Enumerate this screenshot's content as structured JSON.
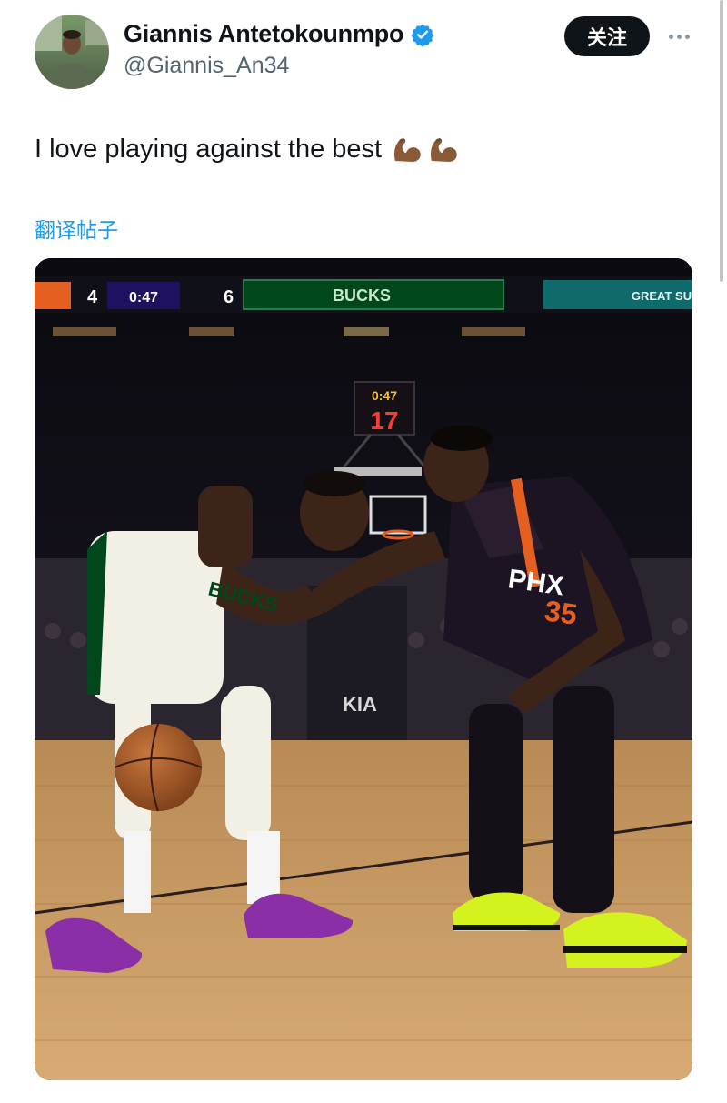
{
  "author": {
    "display_name": "Giannis Antetokounmpo",
    "handle": "@Giannis_An34",
    "avatar_icon": "avatar-photo",
    "verified_icon": "verified-badge-icon",
    "verified_color": "#1d9bf0"
  },
  "actions": {
    "follow_label": "关注",
    "more_icon": "more-icon"
  },
  "tweet": {
    "text": "I love playing against the best",
    "emojis": "💪🏾💪🏾",
    "translate_label": "翻译帖子"
  },
  "media": {
    "scoreboard": {
      "home_score": "4",
      "clock": "0:47",
      "away_score": "6",
      "team_banner": "BUCKS",
      "right_banner": "GREAT SU"
    },
    "shot_clock": {
      "top": "0:47",
      "value": "17"
    },
    "jersey_left": "BUCKS",
    "jersey_right": "PHX",
    "jersey_number": "35",
    "sponsor": "KIA"
  },
  "colors": {
    "accent": "#1d9bf0",
    "bucks_green": "#00471b",
    "suns_purple": "#1d1160",
    "suns_orange": "#e56020",
    "shoe_purple": "#8b2fa8",
    "shoe_volt": "#d4f31e"
  }
}
